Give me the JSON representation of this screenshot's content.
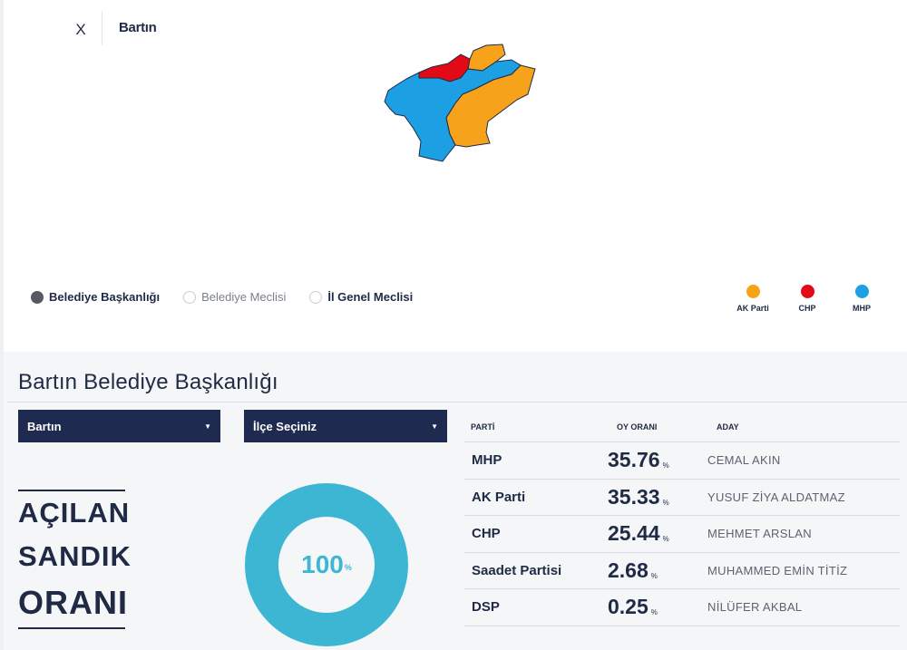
{
  "header": {
    "close_label": "X",
    "title": "Bartın"
  },
  "map": {
    "regions": [
      {
        "name": "map-region-orange-north",
        "color": "#f7a21b"
      },
      {
        "name": "map-region-red",
        "color": "#e30a17"
      },
      {
        "name": "map-region-blue",
        "color": "#1ca0e3"
      },
      {
        "name": "map-region-orange-east",
        "color": "#f7a21b"
      }
    ]
  },
  "election_types": [
    {
      "label": "Belediye Başkanlığı",
      "selected": true
    },
    {
      "label": "Belediye Meclisi",
      "selected": false
    },
    {
      "label": "İl Genel Meclisi",
      "selected": false
    }
  ],
  "legend": [
    {
      "label": "AK Parti",
      "color": "#f7a21b"
    },
    {
      "label": "CHP",
      "color": "#e30a17"
    },
    {
      "label": "MHP",
      "color": "#1ca0e3"
    }
  ],
  "section": {
    "title": "Bartın Belediye Başkanlığı"
  },
  "selects": {
    "province": "Bartın",
    "district": "İlçe Seçiniz",
    "caret": "▼"
  },
  "opened_ballots": {
    "line1": "AÇILAN",
    "line2": "SANDIK",
    "line3": "ORANI",
    "value": "100",
    "unit": "%",
    "fraction": 1.0
  },
  "results": {
    "headers": {
      "party": "PARTİ",
      "rate": "OY ORANI",
      "candidate": "ADAY"
    },
    "unit": "%",
    "rows": [
      {
        "party": "MHP",
        "rate": "35.76",
        "candidate": "CEMAL AKIN"
      },
      {
        "party": "AK Parti",
        "rate": "35.33",
        "candidate": "YUSUF ZİYA ALDATMAZ"
      },
      {
        "party": "CHP",
        "rate": "25.44",
        "candidate": "MEHMET ARSLAN"
      },
      {
        "party": "Saadet Partisi",
        "rate": "2.68",
        "candidate": "MUHAMMED EMİN TİTİZ"
      },
      {
        "party": "DSP",
        "rate": "0.25",
        "candidate": "NİLÜFER AKBAL"
      }
    ]
  }
}
